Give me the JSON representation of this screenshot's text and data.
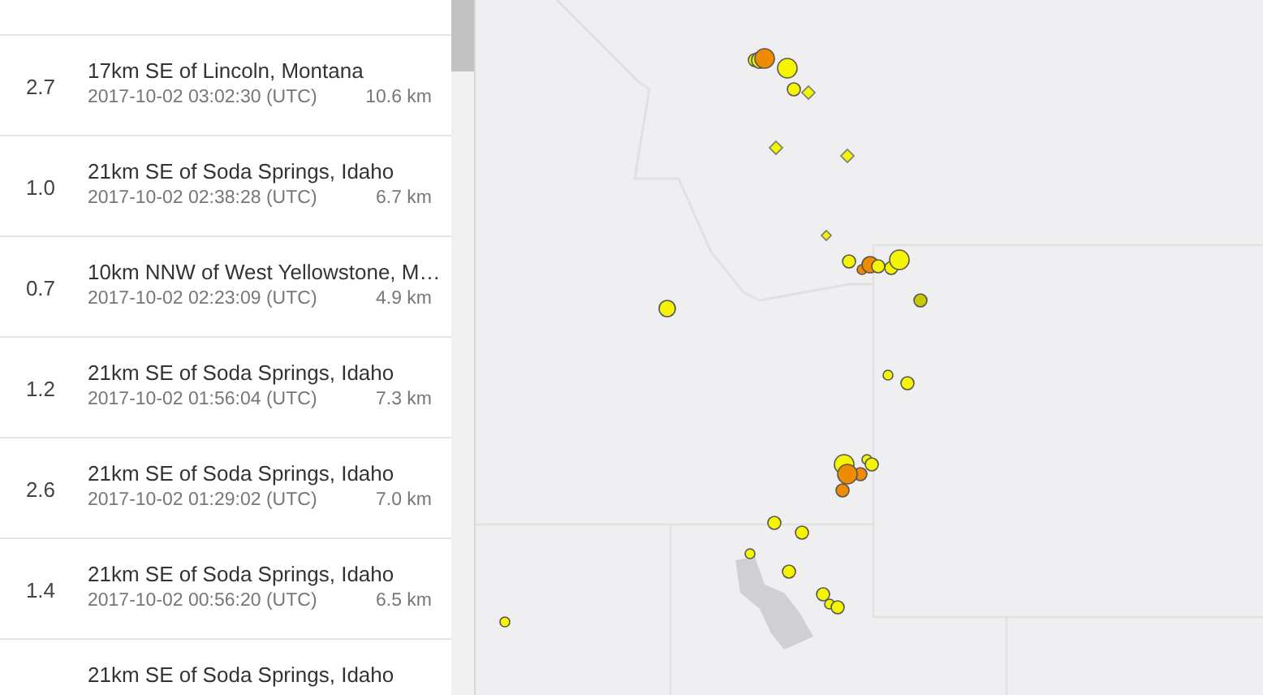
{
  "events": [
    {
      "magnitude": "2.7",
      "place": "17km SE of Lincoln, Montana",
      "time": "2017-10-02 03:02:30 (UTC)",
      "depth": "10.6 km"
    },
    {
      "magnitude": "1.0",
      "place": "21km SE of Soda Springs, Idaho",
      "time": "2017-10-02 02:38:28 (UTC)",
      "depth": "6.7 km"
    },
    {
      "magnitude": "0.7",
      "place": "10km NNW of West Yellowstone, M…",
      "time": "2017-10-02 02:23:09 (UTC)",
      "depth": "4.9 km"
    },
    {
      "magnitude": "1.2",
      "place": "21km SE of Soda Springs, Idaho",
      "time": "2017-10-02 01:56:04 (UTC)",
      "depth": "7.3 km"
    },
    {
      "magnitude": "2.6",
      "place": "21km SE of Soda Springs, Idaho",
      "time": "2017-10-02 01:29:02 (UTC)",
      "depth": "7.0 km"
    },
    {
      "magnitude": "1.4",
      "place": "21km SE of Soda Springs, Idaho",
      "time": "2017-10-02 00:56:20 (UTC)",
      "depth": "6.5 km"
    },
    {
      "place": "21km SE of Soda Springs, Idaho"
    }
  ]
}
